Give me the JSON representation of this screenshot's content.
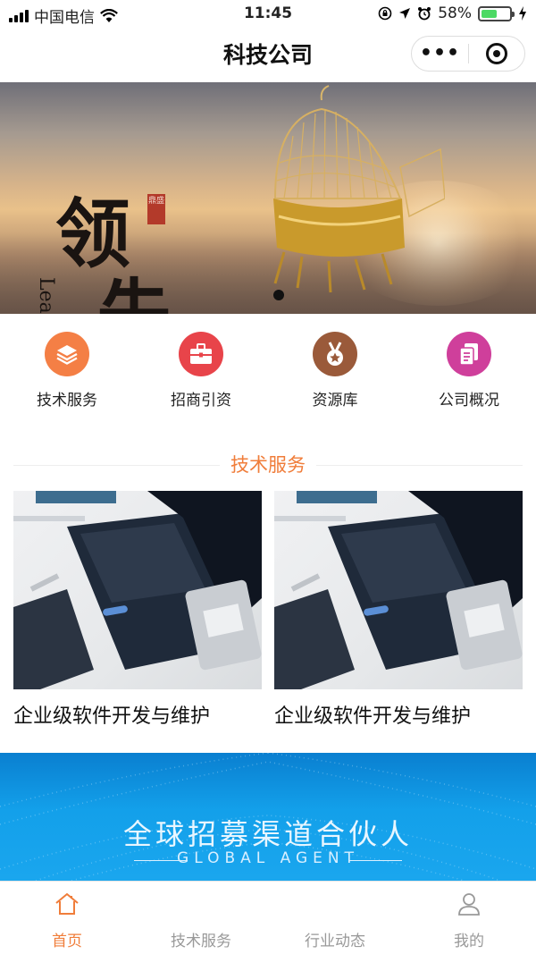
{
  "status_bar": {
    "carrier": "中国电信",
    "time": "11:45",
    "battery": "58%",
    "battery_level": 0.58
  },
  "navbar": {
    "title": "科技公司",
    "more_label": "•••"
  },
  "banner": {
    "calligraphy_1": "领",
    "calligraphy_2": "先",
    "subtitle": "Leading",
    "seal_text": "鼎盛",
    "active_slide": 1
  },
  "quick_links": [
    {
      "label": "技术服务",
      "icon": "layers-icon",
      "color": "#f47f45"
    },
    {
      "label": "招商引资",
      "icon": "briefcase-icon",
      "color": "#e8444a"
    },
    {
      "label": "资源库",
      "icon": "medal-icon",
      "color": "#9a5a3a"
    },
    {
      "label": "公司概况",
      "icon": "document-icon",
      "color": "#cf3f9b"
    }
  ],
  "section": {
    "title": "技术服务"
  },
  "cards": [
    {
      "title": "企业级软件开发与维护"
    },
    {
      "title": "企业级软件开发与维护"
    }
  ],
  "agent_banner": {
    "title": "全球招募渠道合伙人",
    "subtitle": "GLOBAL AGENT"
  },
  "tabbar": [
    {
      "label": "首页",
      "icon": "home-icon",
      "active": true
    },
    {
      "label": "技术服务",
      "icon": "",
      "active": false
    },
    {
      "label": "行业动态",
      "icon": "",
      "active": false
    },
    {
      "label": "我的",
      "icon": "user-icon",
      "active": false
    }
  ],
  "colors": {
    "accent": "#f07d3a",
    "tab_inactive": "#999999",
    "agent_blue": "#13a0ea"
  }
}
